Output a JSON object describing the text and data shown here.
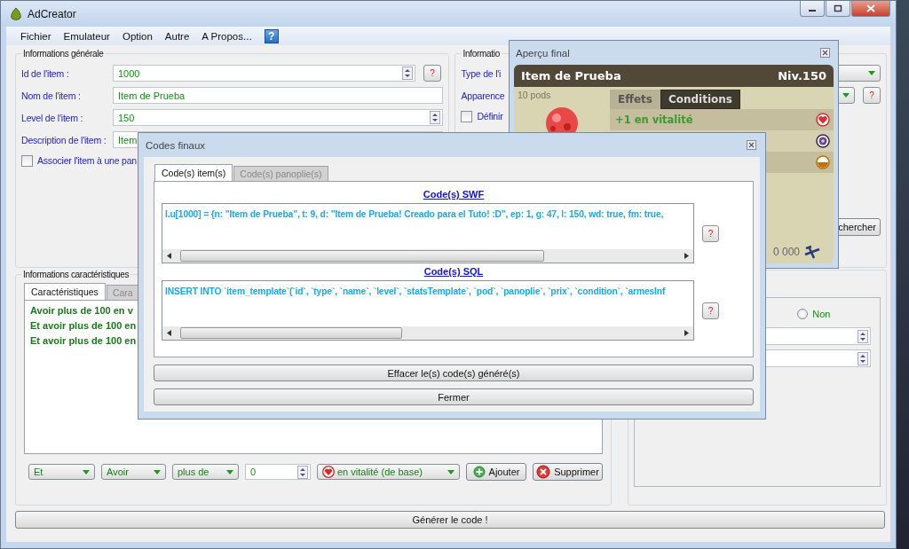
{
  "window": {
    "title": "AdCreator"
  },
  "menu": {
    "items": [
      "Fichier",
      "Emulateur",
      "Option",
      "Autre",
      "A Propos..."
    ],
    "help": "?"
  },
  "general": {
    "title": "Informations générale",
    "fields": [
      {
        "label": "Id de l'item :",
        "value": "1000",
        "kind": "spin",
        "help": "?"
      },
      {
        "label": "Nom de l'item :",
        "value": "Item de Prueba",
        "kind": "text"
      },
      {
        "label": "Level de l'item :",
        "value": "150",
        "kind": "spin"
      },
      {
        "label": "Description de l'item :",
        "value": "Item",
        "kind": "text"
      }
    ],
    "checkbox": {
      "label": "Associer l'item à une pan",
      "checked": false
    }
  },
  "type_info": {
    "title": "Informatio",
    "fields": [
      {
        "label": "Type de l'i",
        "kind": "dropdown"
      },
      {
        "label": "Apparence",
        "kind": "dropdown",
        "help": "?"
      }
    ],
    "checkbox": {
      "label": "Définir",
      "checked": false
    },
    "search_button": "chercher"
  },
  "characteristics": {
    "title": "Informations caractéristiques",
    "tabs": [
      {
        "label": "Caractéristiques",
        "selected": true
      },
      {
        "label": "Cara",
        "selected": false
      }
    ],
    "conditions": [
      "Avoir plus de 100 en v",
      "Et avoir plus de 100 en",
      "Et avoir plus de 100 en"
    ],
    "controls": {
      "operator": "Et",
      "verb": "Avoir",
      "comparison": "plus de",
      "amount": "0",
      "stat": "en vitalité (de base)",
      "add": "Ajouter",
      "remove": "Supprimer"
    }
  },
  "options": {
    "radio": {
      "label": "Non",
      "selected": false
    },
    "fields": [
      {
        "kind": "spin"
      },
      {
        "kind": "spin"
      }
    ]
  },
  "generate_button": "Générer le code !",
  "preview": {
    "title": "Aperçu final",
    "item_name": "Item de Prueba",
    "level": "Niv.150",
    "weight": "10 pods",
    "tabs": [
      {
        "label": "Effets",
        "selected": true
      },
      {
        "label": "Conditions",
        "selected": false
      }
    ],
    "effects": [
      {
        "kind": "heart",
        "text": "+1 en vitalité"
      },
      {
        "kind": "swirl"
      },
      {
        "kind": "half"
      }
    ],
    "price": "0 000"
  },
  "codes": {
    "title": "Codes finaux",
    "tabs": [
      {
        "label": "Code(s) item(s)",
        "selected": true
      },
      {
        "label": "Code(s) panoplie(s)",
        "selected": false
      }
    ],
    "sections": [
      {
        "heading": "Code(s) SWF",
        "code": "I.u[1000] = {n: \"Item de Prueba\", t: 9, d: \"Item de Prueba! Creado para el Tuto! :D\", ep: 1, g: 47, l: 150, wd: true, fm: true,",
        "help": "?"
      },
      {
        "heading": "Code(s) SQL",
        "code": "INSERT INTO `item_template`(`id`, `type`, `name`, `level`, `statsTemplate`, `pod`, `panoplie`, `prix`, `condition`, `armesInf",
        "help": "?"
      }
    ],
    "buttons": [
      "Effacer le(s) code(s) généré(s)",
      "Fermer"
    ]
  }
}
